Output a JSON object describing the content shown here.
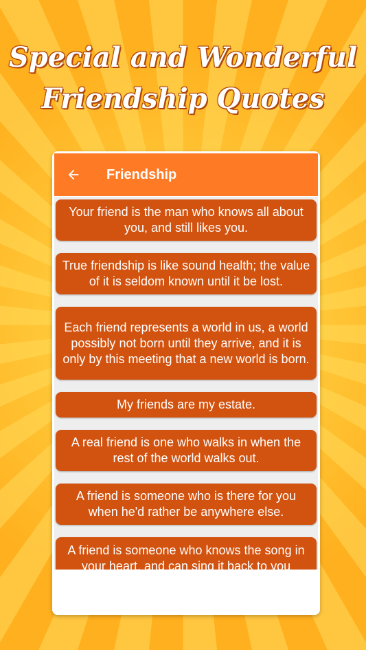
{
  "banner": {
    "line1": "Special and Wonderful",
    "line2": "Friendship Quotes"
  },
  "appbar": {
    "title": "Friendship",
    "back_icon": "arrow-left-icon"
  },
  "quotes": [
    "Your friend is the man who knows all about you, and still likes you.",
    "True friendship is like sound health; the value of it is seldom known until it be lost.",
    "Each friend represents a world in us, a world possibly not born until they arrive, and it is only by this meeting that a new world is born.",
    "My friends are my estate.",
    "A real friend is one who walks in when the rest of the world walks out.",
    "A friend is someone who is there for you when he'd rather be anywhere else.",
    "A friend is someone who knows the song in your heart, and can sing it back to you"
  ],
  "colors": {
    "appbar": "#ff7a25",
    "card": "#d2520f",
    "card_text": "#ffffff"
  }
}
